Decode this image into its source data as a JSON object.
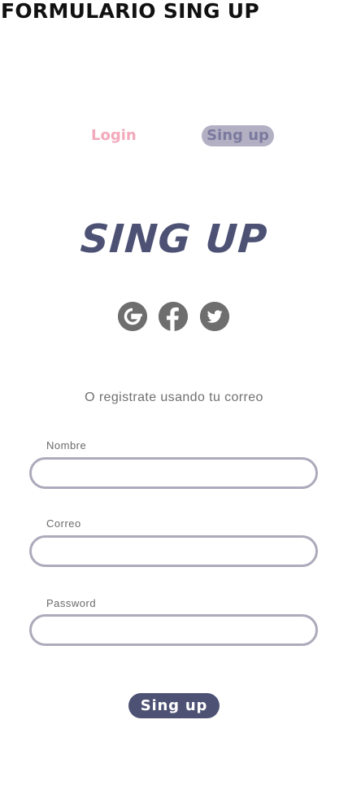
{
  "page": {
    "heading": "FORMULARIO SING UP"
  },
  "tabs": {
    "login_label": "Login",
    "signup_label": "Sing up"
  },
  "form": {
    "title": "SING UP",
    "social": [
      {
        "icon": "google-icon"
      },
      {
        "icon": "facebook-icon"
      },
      {
        "icon": "twitter-icon"
      }
    ],
    "subtitle": "O registrate usando tu correo",
    "fields": {
      "name_label": "Nombre",
      "name_value": "",
      "email_label": "Correo",
      "email_value": "",
      "password_label": "Password",
      "password_value": ""
    },
    "submit_label": "Sing up"
  },
  "colors": {
    "accent": "#4d5275",
    "login_tab": "#f3a9bb",
    "active_tab_bg": "#b3b0c4",
    "input_border": "#adaabb",
    "social_icon": "#6e6e6e"
  }
}
